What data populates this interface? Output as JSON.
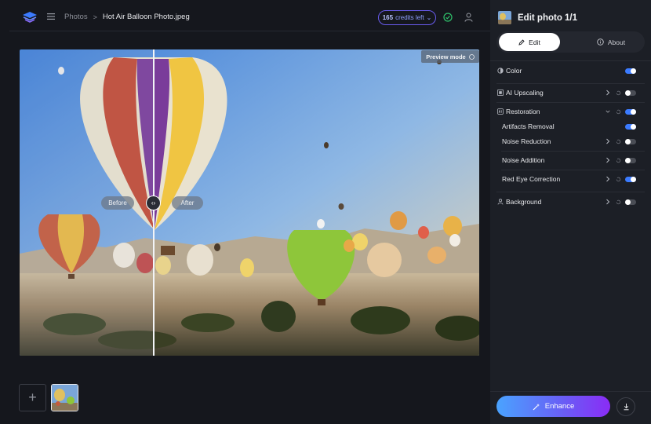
{
  "header": {
    "breadcrumb_root": "Photos",
    "breadcrumb_sep": ">",
    "file_name": "Hot Air Balloon Photo.jpeg",
    "credits_count": "165",
    "credits_suffix": "credits left",
    "credits_caret": "⌄"
  },
  "viewer": {
    "before_label": "Before",
    "after_label": "After",
    "preview_mode_label": "Preview mode",
    "compare_handle_glyph": "‹›"
  },
  "filmstrip": {
    "add_glyph": "+"
  },
  "panel": {
    "title": "Edit photo 1/1",
    "tabs": [
      {
        "label": "Edit",
        "active": true
      },
      {
        "label": "About",
        "active": false
      }
    ],
    "rows": [
      {
        "label": "Color",
        "icon": "color-icon",
        "enabled": true
      },
      {
        "label": "AI Upscaling",
        "icon": "upscale-icon",
        "enabled": false
      },
      {
        "label": "Restoration",
        "icon": "restoration-icon",
        "enabled": true,
        "expanded": true
      },
      {
        "label": "Artifacts Removal",
        "enabled": true
      },
      {
        "label": "Noise Reduction",
        "enabled": false
      },
      {
        "label": "Noise Addition",
        "enabled": false
      },
      {
        "label": "Red Eye Correction",
        "enabled": true
      },
      {
        "label": "Background",
        "icon": "background-icon",
        "enabled": false
      }
    ],
    "enhance_label": "Enhance"
  },
  "colors": {
    "accent": "#3b7bff",
    "enhance_start": "#4aa3ff",
    "enhance_end": "#8a2cf5",
    "credits_border": "#6a5cf0"
  }
}
